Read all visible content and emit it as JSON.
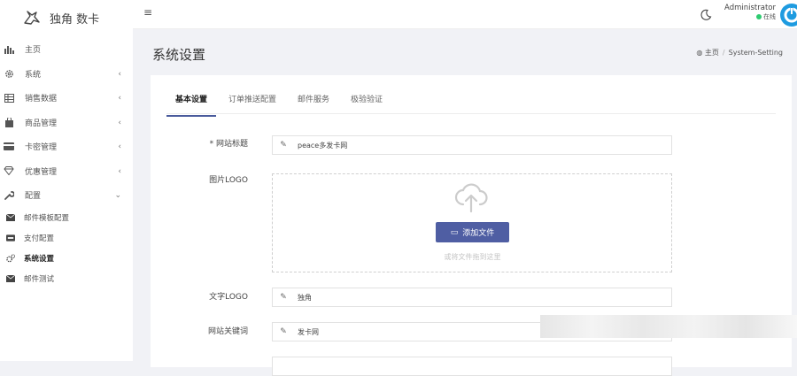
{
  "brand": {
    "name": "独角 数卡"
  },
  "sidebar": {
    "items": [
      {
        "label": "主页",
        "icon": "bar-chart-icon",
        "chevron": ""
      },
      {
        "label": "系统",
        "icon": "gear-icon",
        "chevron": "‹"
      },
      {
        "label": "销售数据",
        "icon": "table-icon",
        "chevron": "‹"
      },
      {
        "label": "商品管理",
        "icon": "shopping-bag-icon",
        "chevron": "‹"
      },
      {
        "label": "卡密管理",
        "icon": "credit-card-icon",
        "chevron": "‹"
      },
      {
        "label": "优惠管理",
        "icon": "diamond-icon",
        "chevron": "‹"
      },
      {
        "label": "配置",
        "icon": "wrench-icon",
        "chevron": "⌄"
      }
    ],
    "subitems": [
      {
        "label": "邮件模板配置",
        "icon": "envelope-icon"
      },
      {
        "label": "支付配置",
        "icon": "visa-icon"
      },
      {
        "label": "系统设置",
        "icon": "cogs-icon",
        "active": true
      },
      {
        "label": "邮件测试",
        "icon": "envelope-icon"
      }
    ]
  },
  "topbar": {
    "user": "Administrator",
    "status": "在线"
  },
  "page": {
    "title": "系统设置"
  },
  "breadcrumb": {
    "home": "主页",
    "current": "System-Setting"
  },
  "tabs": [
    "基本设置",
    "订单推送配置",
    "邮件服务",
    "极验验证"
  ],
  "form": {
    "site_title_label": "* 网站标题",
    "site_title_value": "peace多发卡网",
    "logo_label": "图片LOGO",
    "add_file_label": "添加文件",
    "drop_hint": "或将文件拖到这里",
    "text_logo_label": "文字LOGO",
    "text_logo_value": "独角",
    "keywords_label": "网站关键词",
    "keywords_value": "发卡网"
  },
  "colors": {
    "accent": "#4f5ea3",
    "online": "#2ecc71",
    "avatar": "#1e9be0"
  }
}
